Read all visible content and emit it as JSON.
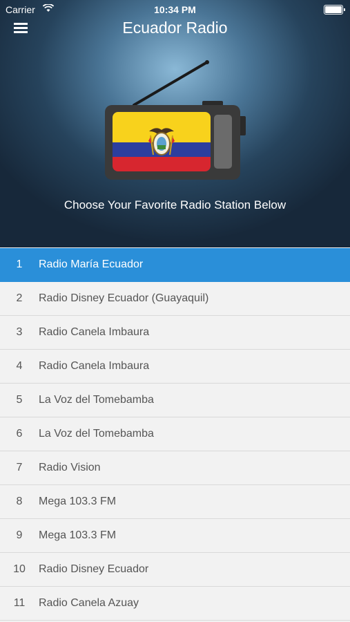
{
  "status_bar": {
    "carrier": "Carrier",
    "time": "10:34 PM"
  },
  "header": {
    "title": "Ecuador Radio",
    "subtitle": "Choose Your Favorite Radio Station Below"
  },
  "icons": {
    "menu": "hamburger-menu-icon",
    "wifi": "wifi-icon",
    "battery": "battery-icon",
    "radio": "radio-with-ecuador-flag-icon"
  },
  "colors": {
    "accent": "#2a8fd9",
    "flag_yellow": "#f8d21c",
    "flag_blue": "#2c3e9e",
    "flag_red": "#d7262f"
  },
  "stations": [
    {
      "num": "1",
      "name": "Radio María Ecuador",
      "selected": true
    },
    {
      "num": "2",
      "name": "Radio Disney Ecuador (Guayaquil)"
    },
    {
      "num": "3",
      "name": "Radio Canela Imbaura"
    },
    {
      "num": "4",
      "name": "Radio Canela Imbaura"
    },
    {
      "num": "5",
      "name": "La Voz del Tomebamba"
    },
    {
      "num": "6",
      "name": "La Voz del Tomebamba"
    },
    {
      "num": "7",
      "name": "Radio Vision"
    },
    {
      "num": "8",
      "name": "Mega 103.3 FM"
    },
    {
      "num": "9",
      "name": "Mega 103.3 FM"
    },
    {
      "num": "10",
      "name": "Radio Disney Ecuador"
    },
    {
      "num": "11",
      "name": "Radio Canela Azuay"
    }
  ]
}
